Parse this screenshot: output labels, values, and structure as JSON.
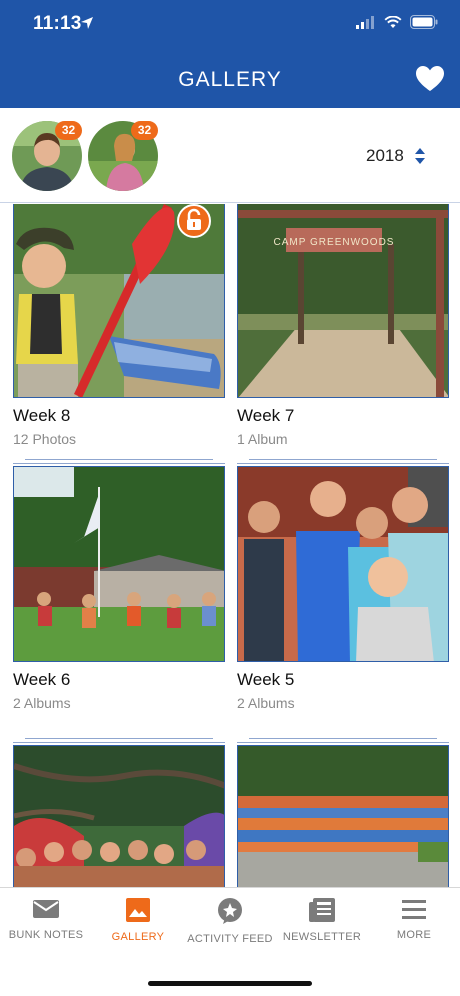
{
  "status": {
    "time": "11:13"
  },
  "header": {
    "title": "GALLERY"
  },
  "profiles": [
    {
      "badge": "32"
    },
    {
      "badge": "32"
    }
  ],
  "year_selector": {
    "value": "2018"
  },
  "gallery": [
    {
      "title": "Week 8",
      "subtitle": "12 Photos"
    },
    {
      "title": "Week 7",
      "subtitle": "1 Album"
    },
    {
      "title": "Week 6",
      "subtitle": "2 Albums"
    },
    {
      "title": "Week 5",
      "subtitle": "2 Albums"
    },
    {
      "title": "",
      "subtitle": ""
    },
    {
      "title": "",
      "subtitle": ""
    }
  ],
  "sign_text": "CAMP GREENWOODS",
  "tabs": [
    {
      "label": "BUNK NOTES",
      "icon": "envelope-icon"
    },
    {
      "label": "GALLERY",
      "icon": "image-icon",
      "active": true
    },
    {
      "label": "ACTIVITY FEED",
      "icon": "chat-bubble-icon"
    },
    {
      "label": "NEWSLETTER",
      "icon": "newspaper-icon"
    },
    {
      "label": "MORE",
      "icon": "menu-icon"
    }
  ],
  "colors": {
    "brand_blue": "#1f55a8",
    "accent_orange": "#ee6a1a",
    "tab_gray": "#7b7b7b"
  }
}
